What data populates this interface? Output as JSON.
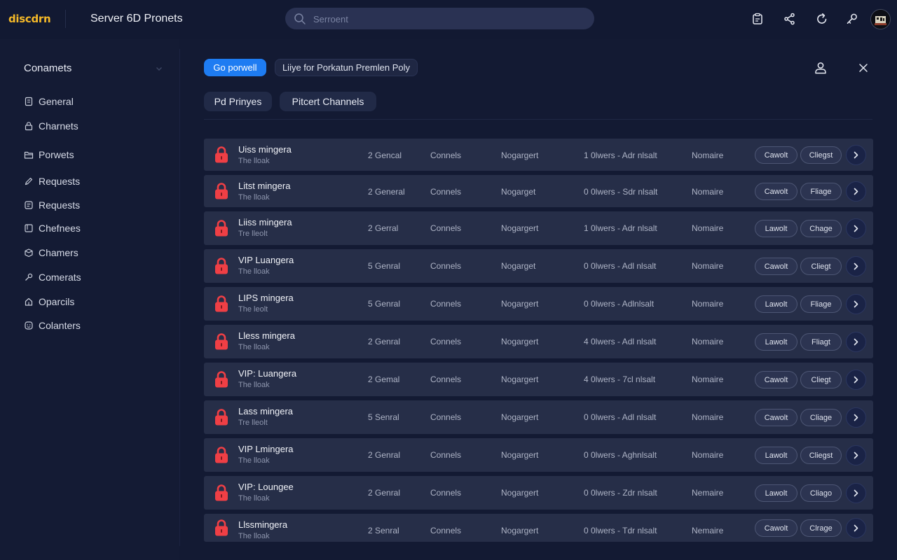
{
  "app": {
    "logo": "discdrn",
    "server_title": "Server 6D Pronets"
  },
  "search": {
    "placeholder": "Serroent"
  },
  "top_icons": [
    "clipboard-icon",
    "share-icon",
    "refresh-icon",
    "key-icon",
    "user-avatar"
  ],
  "sidebar": {
    "title": "Conamets",
    "items": [
      {
        "label": "General",
        "icon": "book-icon"
      },
      {
        "label": "Charnets",
        "icon": "lock-icon"
      },
      {
        "label": "Porwets",
        "icon": "folder-icon"
      },
      {
        "label": "Requests",
        "icon": "pencil-icon"
      },
      {
        "label": "Requests",
        "icon": "note-icon"
      },
      {
        "label": "Chefnees",
        "icon": "tag-icon"
      },
      {
        "label": "Chamers",
        "icon": "box-icon"
      },
      {
        "label": "Comerats",
        "icon": "key-icon"
      },
      {
        "label": "Oparcils",
        "icon": "house-icon"
      },
      {
        "label": "Colanters",
        "icon": "smiley-icon"
      }
    ]
  },
  "filters": {
    "primary": "Go porwell",
    "secondary": "Liiye for Porkatun Premlen Poly"
  },
  "subfilters": [
    "Pd Prinyes",
    "Pitcert Channels"
  ],
  "colors": {
    "accent": "#1e7cf2",
    "lock": "#ef3f45",
    "brand": "#f5b928"
  },
  "channels": [
    {
      "name": "Uiss mingera",
      "sub": "The lloak",
      "col1": "2 Gencal",
      "col2": "Connels",
      "col3": "Nogargert",
      "col4": "1 0lwers - Adr nlsalt",
      "col5": "Nomaire",
      "btn1": "Cawolt",
      "btn2": "Cliegst"
    },
    {
      "name": "Litst mingera",
      "sub": "The lloak",
      "col1": "2 General",
      "col2": "Connels",
      "col3": "Nogarget",
      "col4": "0 0lwers - Sdr nlsalt",
      "col5": "Nomaire",
      "btn1": "Cawolt",
      "btn2": "Fliage"
    },
    {
      "name": "Liiss mingera",
      "sub": "Tre lleolt",
      "col1": "2 Gerral",
      "col2": "Connels",
      "col3": "Nogargert",
      "col4": "1 0lwers - Adr nlsalt",
      "col5": "Nomaire",
      "btn1": "Lawolt",
      "btn2": "Chage"
    },
    {
      "name": "VIP Luangera",
      "sub": "The lloak",
      "col1": "5 Genral",
      "col2": "Connels",
      "col3": "Nogarget",
      "col4": "0 0lwers - Adl nlsalt",
      "col5": "Nomaire",
      "btn1": "Cawolt",
      "btn2": "Cliegt"
    },
    {
      "name": "LIPS mingera",
      "sub": "The leolt",
      "col1": "5 Genral",
      "col2": "Connels",
      "col3": "Nogargert",
      "col4": "0 0lwers - Adlnlsalt",
      "col5": "Nomaire",
      "btn1": "Lawolt",
      "btn2": "Fliage"
    },
    {
      "name": "Lless mingera",
      "sub": "The lloak",
      "col1": "2 Genral",
      "col2": "Connels",
      "col3": "Nogargert",
      "col4": "4 0lwers - Adl nlsalt",
      "col5": "Nomaire",
      "btn1": "Lawolt",
      "btn2": "Fliagt"
    },
    {
      "name": "VIP: Luangera",
      "sub": "The lloak",
      "col1": "2 Gemal",
      "col2": "Connels",
      "col3": "Nogargert",
      "col4": "4 0lwers - 7cl nlsalt",
      "col5": "Nomaire",
      "btn1": "Cawolt",
      "btn2": "Cliegt"
    },
    {
      "name": "Lass mingera",
      "sub": "Tre lleolt",
      "col1": "5 Senral",
      "col2": "Connels",
      "col3": "Nogargert",
      "col4": "0 0lwers - Adl nlsalt",
      "col5": "Nomaire",
      "btn1": "Cawolt",
      "btn2": "Cliage"
    },
    {
      "name": "VIP Lmingera",
      "sub": "The lloak",
      "col1": "2 Genral",
      "col2": "Connels",
      "col3": "Nogargert",
      "col4": "0 0lwers - Aghnlsalt",
      "col5": "Nomaire",
      "btn1": "Lawolt",
      "btn2": "Cliegst"
    },
    {
      "name": "VIP: Loungee",
      "sub": "The lloak",
      "col1": "2 Genral",
      "col2": "Connels",
      "col3": "Nogargert",
      "col4": "0 0lwers - Zdr nlsalt",
      "col5": "Nemaire",
      "btn1": "Lawolt",
      "btn2": "Cliago"
    },
    {
      "name": "Llssmingera",
      "sub": "The lloak",
      "col1": "2 Senral",
      "col2": "Connels",
      "col3": "Nogargert",
      "col4": "0 0lwers - Tdr nlsalt",
      "col5": "Nemaire",
      "btn1": "Cawolt",
      "btn2": "Clrage"
    }
  ]
}
